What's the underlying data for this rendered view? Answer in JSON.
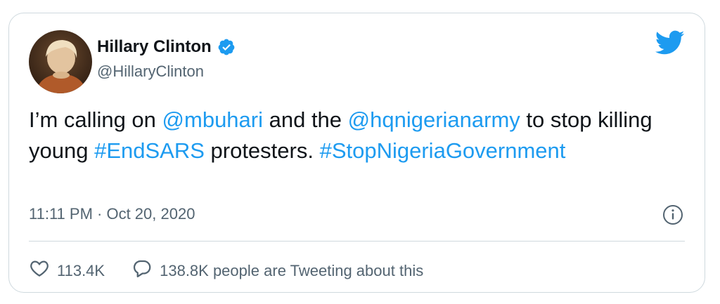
{
  "tweet": {
    "author": {
      "display_name": "Hillary Clinton",
      "handle": "@HillaryClinton",
      "verified": true
    },
    "text_parts": [
      {
        "text": "I’m calling on ",
        "type": "text"
      },
      {
        "text": "@mbuhari",
        "type": "mention"
      },
      {
        "text": " and the ",
        "type": "text"
      },
      {
        "text": "@hqnigerianarmy",
        "type": "mention"
      },
      {
        "text": " to stop killing young ",
        "type": "text"
      },
      {
        "text": "#EndSARS",
        "type": "hashtag"
      },
      {
        "text": " protesters. ",
        "type": "text"
      },
      {
        "text": "#StopNigeriaGovernment",
        "type": "hashtag"
      }
    ],
    "timestamp": "11:11 PM · Oct 20, 2020",
    "likes": "113.4K",
    "tweeting_about": "138.8K people are Tweeting about this"
  },
  "icons": {
    "verified": "verified-badge-icon",
    "brand": "twitter-bird-icon",
    "info": "info-icon",
    "like": "heart-icon",
    "reply": "speech-bubble-icon"
  },
  "colors": {
    "link": "#1d9bf0",
    "text": "#0f1419",
    "secondary": "#536471",
    "border": "#cfd9de"
  }
}
